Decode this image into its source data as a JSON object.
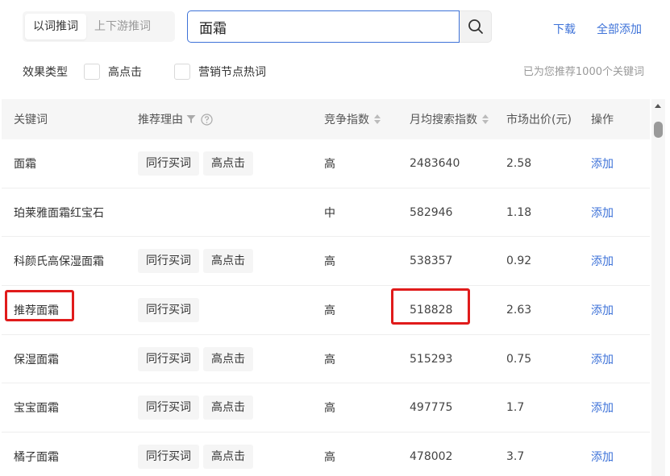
{
  "tabs": [
    {
      "label": "以词推词",
      "active": true
    },
    {
      "label": "上下游推词",
      "active": false
    }
  ],
  "search": {
    "value": "面霜"
  },
  "actions": {
    "download": "下载",
    "add_all": "全部添加"
  },
  "filter": {
    "label": "效果类型",
    "options": [
      "高点击",
      "营销节点热词"
    ],
    "count_text": "已为您推荐1000个关键词"
  },
  "table": {
    "headers": {
      "keyword": "关键词",
      "reason": "推荐理由",
      "competition": "竞争指数",
      "search_volume": "月均搜索指数",
      "price": "市场出价(元)",
      "op": "操作"
    },
    "add_label": "添加",
    "rows": [
      {
        "keyword": "面霜",
        "reasons": [
          "同行买词",
          "高点击"
        ],
        "competition": "高",
        "search_volume": "2483640",
        "price": "2.58"
      },
      {
        "keyword": "珀莱雅面霜红宝石",
        "reasons": [],
        "competition": "中",
        "search_volume": "582946",
        "price": "1.18"
      },
      {
        "keyword": "科颜氏高保湿面霜",
        "reasons": [
          "同行买词",
          "高点击"
        ],
        "competition": "高",
        "search_volume": "538357",
        "price": "0.92"
      },
      {
        "keyword": "推荐面霜",
        "reasons": [
          "同行买词"
        ],
        "competition": "高",
        "search_volume": "518828",
        "price": "2.63"
      },
      {
        "keyword": "保湿面霜",
        "reasons": [
          "同行买词",
          "高点击"
        ],
        "competition": "高",
        "search_volume": "515293",
        "price": "0.75"
      },
      {
        "keyword": "宝宝面霜",
        "reasons": [
          "同行买词",
          "高点击"
        ],
        "competition": "高",
        "search_volume": "497775",
        "price": "1.7"
      },
      {
        "keyword": "橘子面霜",
        "reasons": [
          "同行买词",
          "高点击"
        ],
        "competition": "高",
        "search_volume": "478002",
        "price": "3.7"
      }
    ]
  },
  "colors": {
    "accent": "#3d72d8",
    "highlight": "#e01b1b"
  },
  "icons": {
    "search": "search-icon",
    "filter": "funnel-icon",
    "help": "question-icon",
    "sort": "sort-icon"
  }
}
